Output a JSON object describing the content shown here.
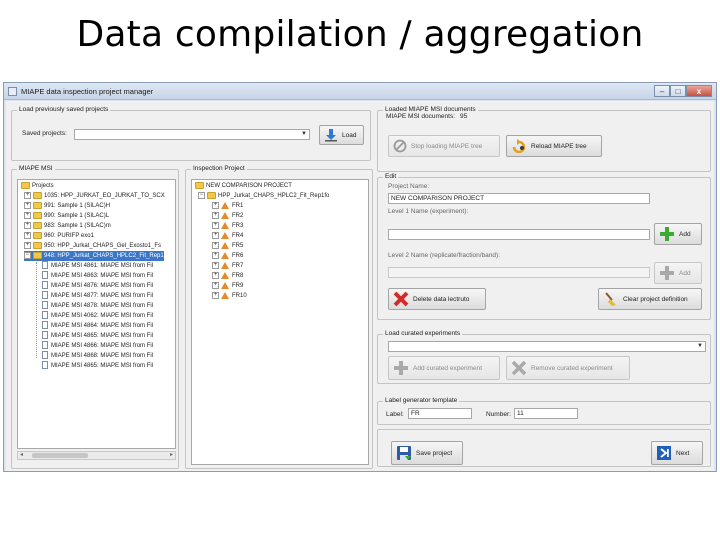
{
  "slide": {
    "title": "Data compilation / aggregation"
  },
  "window": {
    "title": "MIAPE data inspection project manager",
    "min": "–",
    "max": "□",
    "close": "x"
  },
  "load_saved": {
    "group_label": "Load previously saved projects",
    "saved_projects_label": "Saved projects:",
    "saved_projects_value": "",
    "load_button": "Load"
  },
  "loaded_docs": {
    "group_label": "Loaded MIAPE MSI documents",
    "count_label": "MIAPE MSI documents:",
    "count_value": "95",
    "stop_button": "Stop loading MIAPE tree",
    "reload_button": "Reload MIAPE tree"
  },
  "miape_tree": {
    "group_label": "MIAPE MSI",
    "root": "Projects",
    "items": [
      {
        "label": "1035: HPP_JURKAT_EO_JURKAT_TO_SCX",
        "type": "folder",
        "selected": false
      },
      {
        "label": "991: Sample 1 (SILAC)H",
        "type": "folder",
        "selected": false
      },
      {
        "label": "990: Sample 1 (SILAC)L",
        "type": "folder",
        "selected": false
      },
      {
        "label": "983: Sample 1 (SILAC)m",
        "type": "folder",
        "selected": false
      },
      {
        "label": "960: PURIFP exo1",
        "type": "folder",
        "selected": false
      },
      {
        "label": "950: HPP_Jurkat_CHAPS_Gel_Exosto1_Fs",
        "type": "folder",
        "selected": false
      },
      {
        "label": "948: HPP_Jurkat_CHAPS_HPLC2_Fit_Rep1",
        "type": "folder",
        "selected": true
      },
      {
        "label": "MIAPE MSI 4861: MIAPE MSI from Fil",
        "type": "doc",
        "selected": false
      },
      {
        "label": "MIAPE MSI 4863: MIAPE MSI from Fil",
        "type": "doc",
        "selected": false
      },
      {
        "label": "MIAPE MSI 4876: MIAPE MSI from Fil",
        "type": "doc",
        "selected": false
      },
      {
        "label": "MIAPE MSI 4877: MIAPE MSI from Fil",
        "type": "doc",
        "selected": false
      },
      {
        "label": "MIAPE MSI 4878: MIAPE MSI from Fil",
        "type": "doc",
        "selected": false
      },
      {
        "label": "MIAPE MSI 4062: MIAPE MSI from Fil",
        "type": "doc",
        "selected": false
      },
      {
        "label": "MIAPE MSI 4864: MIAPE MSI from Fil",
        "type": "doc",
        "selected": false
      },
      {
        "label": "MIAPE MSI 4865: MIAPE MSI from Fil",
        "type": "doc",
        "selected": false
      },
      {
        "label": "MIAPE MSI 4866: MIAPE MSI from Fil",
        "type": "doc",
        "selected": false
      },
      {
        "label": "MIAPE MSI 4868: MIAPE MSI from Fil",
        "type": "doc",
        "selected": false
      },
      {
        "label": "MIAPE MSI 4865: MIAPE MSI from Fil",
        "type": "doc",
        "selected": false
      }
    ]
  },
  "inspection_tree": {
    "group_label": "Inspection Project",
    "root": "NEW COMPARISON PROJECT",
    "child": "HPP_Jurkat_CHAPS_HPLC2_Fit_Rep1fo",
    "items": [
      "FR1",
      "FR2",
      "FR3",
      "FR4",
      "FR5",
      "FR6",
      "FR7",
      "FR8",
      "FR9",
      "FR10"
    ]
  },
  "edit": {
    "group_label": "Edit",
    "project_name_label": "Project Name:",
    "project_name_value": "NEW COMPARISON PROJECT",
    "level1_label": "Level 1 Name (experiment):",
    "level1_value": "",
    "add_button": "Add",
    "level2_label": "Level 2 Name (replicate/fraction/band):",
    "level2_value": "",
    "add2_button": "Add",
    "delete_button": "Delete data lectruto",
    "clear_button": "Clear project definition"
  },
  "curated": {
    "group_label": "Load curated experiments",
    "select_value": "",
    "add_button": "Add curated experiment",
    "remove_button": "Remove curated experiment"
  },
  "label_gen": {
    "group_label": "Label generator template",
    "label_label": "Label:",
    "label_value": "FR",
    "number_label": "Number:",
    "number_value": "11"
  },
  "footer": {
    "save_button": "Save project",
    "next_button": "Next"
  }
}
